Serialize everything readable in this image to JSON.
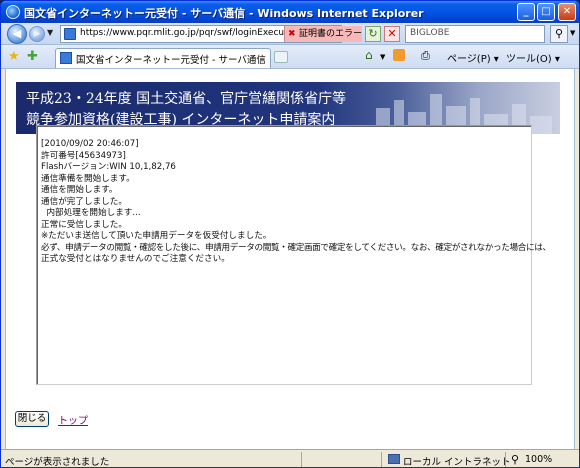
{
  "window": {
    "title": "国文省インターネットー元受付 - サーバ通信 - Windows Internet Explorer",
    "min_glyph": "_",
    "max_glyph": "□",
    "close_glyph": "✕"
  },
  "address_bar": {
    "url": "https://www.pqr.mlit.go.jp/pqr/swf/loginExecute.do;j",
    "cert_error": "証明書のエラー",
    "search_placeholder": "BIGLOBE"
  },
  "tab": {
    "title": "国文省インターネットー元受付 - サーバ通信"
  },
  "command_bar": {
    "page_label": "ページ(P) ▾",
    "tools_label": "ツール(O) ▾"
  },
  "banner": {
    "line1": "平成23・24年度 国土交通省、官庁営繕関係省庁等",
    "line2": "競争参加資格(建設工事) インターネット申請案内"
  },
  "log": {
    "lines": [
      "[2010/09/02 20:46:07]",
      "許可番号[45634973]",
      "Flashバージョン:WIN 10,1,82,76",
      "通信準備を開始します。",
      "通信を開始します。",
      "通信が完了しました。",
      "  内部処理を開始します...",
      "正常に受信しました。",
      "※ただいま送信して頂いた申請用データを仮受付しました。",
      "必ず、申請データの閲覧・確認をした後に、申請用データの閲覧・確定画面で確定をしてください。なお、確定がされなかった場合には、",
      "正式な受付とはなりませんのでご注意ください。"
    ]
  },
  "buttons": {
    "close": "閉じる",
    "top_link": "トップ"
  },
  "status_bar": {
    "text": "ページが表示されました",
    "zone": "ローカル イントラネット",
    "zoom": "100%"
  }
}
